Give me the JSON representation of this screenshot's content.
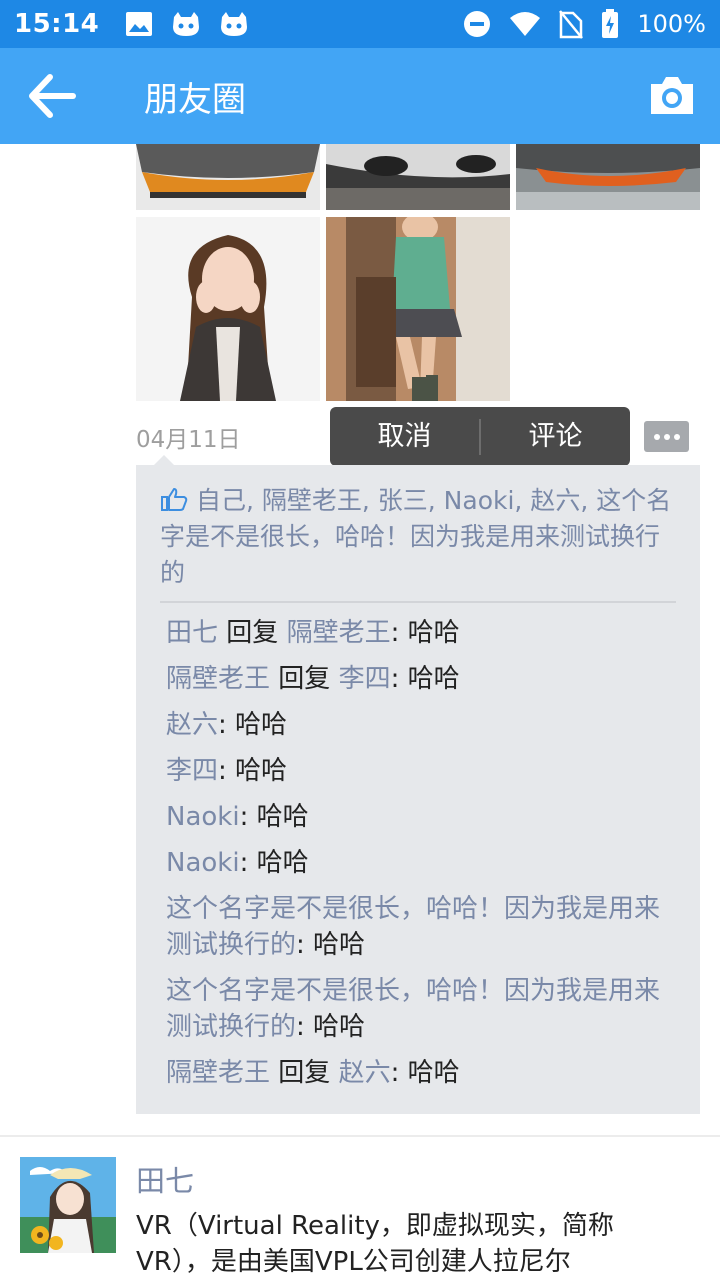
{
  "status_bar": {
    "time": "15:14",
    "battery": "100%",
    "icons": [
      "image-icon",
      "cat-icon",
      "cat-icon",
      "dnd-icon",
      "wifi-icon",
      "no-sim-icon",
      "battery-icon"
    ]
  },
  "app_bar": {
    "title": "朋友圈",
    "back_icon": "arrow-left-icon",
    "camera_icon": "camera-icon"
  },
  "post": {
    "date": "04月11日",
    "popup": {
      "cancel": "取消",
      "comment": "评论"
    },
    "likes_text": "自己, 隔壁老王, 张三, Naoki, 赵六, 这个名字是不是很长，哈哈！因为我是用来测试换行的",
    "comments": [
      {
        "from": "田七",
        "reply_word": "回复",
        "to": "隔壁老王",
        "text": ": 哈哈"
      },
      {
        "from": "隔壁老王",
        "reply_word": "回复",
        "to": "李四",
        "text": ": 哈哈"
      },
      {
        "from": "赵六",
        "reply_word": "",
        "to": "",
        "text": ": 哈哈"
      },
      {
        "from": "李四",
        "reply_word": "",
        "to": "",
        "text": ": 哈哈"
      },
      {
        "from": "Naoki",
        "reply_word": "",
        "to": "",
        "text": ": 哈哈"
      },
      {
        "from": "Naoki",
        "reply_word": "",
        "to": "",
        "text": ": 哈哈"
      },
      {
        "from": "这个名字是不是很长，哈哈！因为我是用来测试换行的",
        "reply_word": "",
        "to": "",
        "text": ": 哈哈"
      },
      {
        "from": "这个名字是不是很长，哈哈！因为我是用来测试换行的",
        "reply_word": "",
        "to": "",
        "text": ": 哈哈"
      },
      {
        "from": "隔壁老王",
        "reply_word": "回复",
        "to": "赵六",
        "text": ": 哈哈"
      }
    ]
  },
  "next_post": {
    "name": "田七",
    "text": "VR（Virtual Reality，即虚拟现实，简称VR），是由美国VPL公司创建人拉尼尔"
  },
  "colors": {
    "status_bar": "#1e88e5",
    "app_bar": "#42a5f5",
    "name_link": "#7a89a8",
    "comment_bg": "#e6e8eb",
    "popup_bg": "#4a4a4a"
  }
}
